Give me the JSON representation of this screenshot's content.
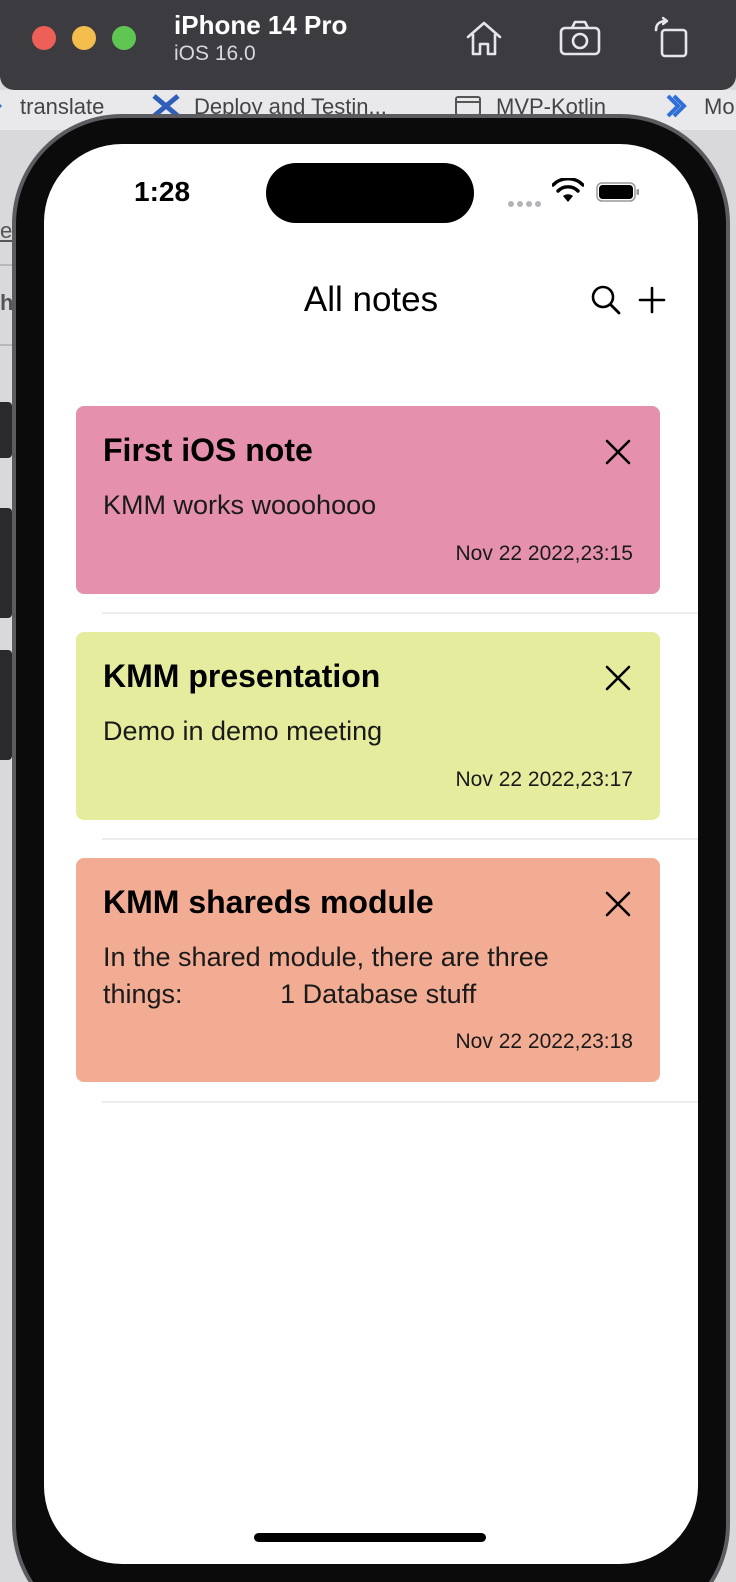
{
  "simulator": {
    "device": "iPhone 14 Pro",
    "os": "iOS 16.0",
    "icons": [
      "home-icon",
      "screenshot-icon",
      "rotate-icon"
    ]
  },
  "bookmarks": [
    {
      "label": "translate",
      "icon": "translate-icon"
    },
    {
      "label": "Deploy and Testin...",
      "icon": "deploy-icon"
    },
    {
      "label": "MVP-Kotlin",
      "icon": "folder-icon"
    },
    {
      "label": "Mo",
      "icon": "jira-icon"
    }
  ],
  "behind_text": [
    "e",
    "h"
  ],
  "status_bar": {
    "time": "1:28"
  },
  "nav": {
    "title": "All notes",
    "icons": [
      "search-icon",
      "plus-icon"
    ]
  },
  "notes": [
    {
      "title": "First iOS note",
      "body": "KMM works wooohooo",
      "date": "Nov 22 2022,23:15",
      "color": "#e591ae"
    },
    {
      "title": "KMM presentation",
      "body": "Demo in demo meeting",
      "date": "Nov 22 2022,23:17",
      "color": "#e5ec9e"
    },
    {
      "title": "KMM shareds module",
      "body": "In the shared module, there are three\nthings:             1 Database stuff",
      "date": "Nov 22 2022,23:18",
      "color": "#f2ac94"
    }
  ]
}
